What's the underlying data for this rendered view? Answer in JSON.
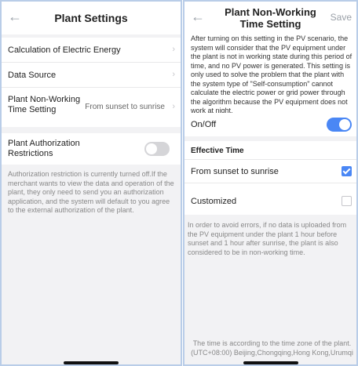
{
  "left": {
    "title": "Plant Settings",
    "rows": [
      {
        "label": "Calculation of Electric Energy",
        "value": ""
      },
      {
        "label": "Data Source",
        "value": ""
      },
      {
        "label": "Plant Non-Working\nTime Setting",
        "value": "From sunset to sunrise"
      }
    ],
    "authorization": {
      "label": "Plant Authorization\nRestrictions",
      "enabled": false,
      "note": "Authorization restriction is currently turned off.If the merchant wants to view the data and operation of the plant, they only need to send you an authorization application, and the system will default to you agree to the external authorization of the plant."
    }
  },
  "right": {
    "title": "Plant Non-Working\nTime Setting",
    "save_label": "Save",
    "description": "After turning on this setting in the PV scenario, the system will consider that the PV equipment under the plant is not in working state during this period of time, and no PV power is generated. This setting is only used to solve the problem that the plant with the system type of \"Self-consumption\" cannot calculate the electric power or grid power through the algorithm because the PV equipment does not work at night.",
    "onoff_label": "On/Off",
    "onoff_enabled": true,
    "effective_time_header": "Effective Time",
    "options": [
      {
        "label": "From sunset to sunrise",
        "checked": true
      },
      {
        "label": "Customized",
        "checked": false
      }
    ],
    "note": "In order to avoid errors, if no data is uploaded from the PV equipment under the plant 1 hour before sunset and 1 hour after sunrise, the plant is also considered to be  in non-working time.",
    "footer": "The time is according to the time zone of the plant.\n(UTC+08:00) Beijing,Chongqing,Hong Kong,Urumqi"
  },
  "colors": {
    "accent": "#4a87f5",
    "background": "#f2f2f4",
    "toggle_off": "#d5d5d8"
  },
  "icons": {
    "back": "arrow-left-icon",
    "chevron": "chevron-right-icon"
  }
}
